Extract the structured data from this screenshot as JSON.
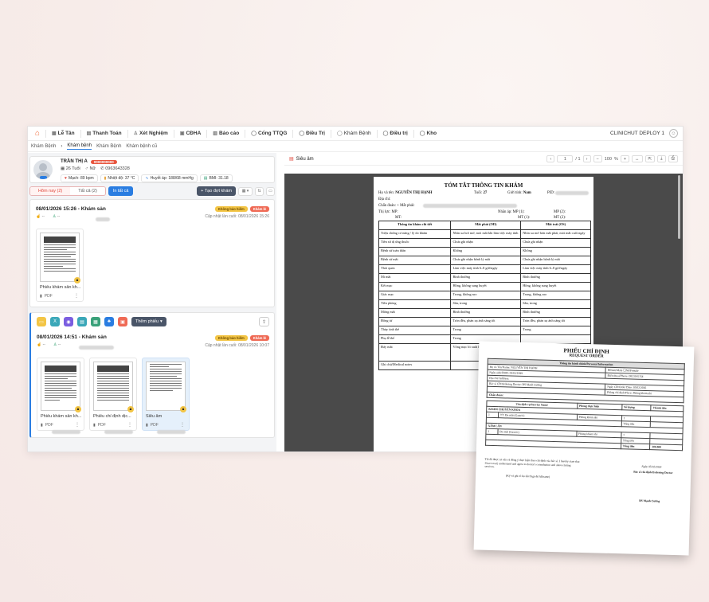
{
  "nav": {
    "items": [
      {
        "icon": "calendar-icon",
        "label": "Lễ Tân"
      },
      {
        "icon": "receipt-icon",
        "label": "Thanh Toán"
      },
      {
        "icon": "user-icon",
        "label": "Xét Nghiệm"
      },
      {
        "icon": "image-icon",
        "label": "CĐHA"
      },
      {
        "icon": "doc-icon",
        "label": "Báo cáo"
      },
      {
        "icon": "circle-icon",
        "label": "Cổng TTQG"
      },
      {
        "icon": "circle-icon",
        "label": "Điều Trị"
      },
      {
        "icon": "circle-icon",
        "label": "Khám Bệnh"
      },
      {
        "icon": "circle-icon",
        "label": "Điều trị"
      },
      {
        "icon": "circle-icon",
        "label": "Kho"
      }
    ],
    "right_label": "CLINICHUT DEPLOY 1"
  },
  "breadcrumb": {
    "items": [
      "Khám Bệnh",
      "Khám bệnh",
      "Khám Bệnh",
      "Khám bệnh cũ"
    ]
  },
  "patient": {
    "name": "TRẦN THỊ A",
    "id_badge": "0000000000",
    "age": "26 Tuổi",
    "gender": "Nữ",
    "phone": "0963643328",
    "vitals": [
      {
        "icon": "heart-icon",
        "text": "Mạch: 89 bpm"
      },
      {
        "icon": "thermometer-icon",
        "text": "Nhiệt độ: 37 °C"
      },
      {
        "icon": "pulse-icon",
        "text": "Huyết áp: 188/68 mmHg"
      },
      {
        "icon": "scale-icon",
        "text": "BMI: 31.18"
      }
    ]
  },
  "filters": {
    "today": "Hôm nay (2)",
    "all": "Tất cả (2)",
    "print_all": "In tất cả",
    "create": "+ Tạo đợt khám"
  },
  "visits": [
    {
      "title": "08/01/2026 15:26 - Khám sản",
      "tag_yellow": "Không bảo hiểm",
      "tag_red": "Khám lẻ",
      "updated": "Cập nhật lần cuối: 08/01/2026 15:26",
      "meta_a": "--",
      "meta_b": "--",
      "docs": [
        {
          "name": "Phiếu khám sản kh...",
          "type": "PDF"
        }
      ]
    },
    {
      "title": "08/01/2026 14:51 - Khám sản",
      "tag_yellow": "Không bảo hiểm",
      "tag_red": "Khám lẻ",
      "updated": "Cập nhật lần cuối: 08/01/2026 10:07",
      "meta_a": "--",
      "meta_b": "--",
      "more_button": "Thêm phiếu",
      "docs": [
        {
          "name": "Phiếu khám sản kh...",
          "type": "PDF"
        },
        {
          "name": "Phiếu chỉ định dịc...",
          "type": "PDF"
        },
        {
          "name": "Siêu âm",
          "type": "PDF"
        }
      ]
    }
  ],
  "viewer": {
    "title": "Siêu âm",
    "page_current": "1",
    "page_total": "/ 1",
    "zoom": "100",
    "zoom_unit": "%"
  },
  "summary": {
    "title": "TÓM TẮT THÔNG TIN KHÁM",
    "name_label": "Họ và tên:",
    "name": "NGUYỄN THỊ HẠNH",
    "age_label": "Tuổi:",
    "age": "27",
    "gender_label": "Giới tính:",
    "gender": "Nam",
    "pid_label": "PID:",
    "address_label": "Địa chỉ:",
    "diag_label": "Chẩn đoán:",
    "diag_value": "+ Mắt phải:",
    "vision_label": "Thị lực:",
    "mp_label": "MP:",
    "mt_label": "MT:",
    "iop_label": "Nhãn áp:",
    "iop_mp": "MP (1):",
    "iop_mt": "MT (1):",
    "mp2": "MP (2):",
    "mt2": "MT (2):",
    "headers": [
      "Thông tin khám chi tiết",
      "Mắt phải (OD)",
      "Mắt trái (OS)"
    ],
    "rows": [
      [
        "Triệu chứng cơ năng / lý do khám",
        "Nhìn xa hơi mờ, mỏi mắt khi làm việc máy tính",
        "Nhìn xa mờ hơn mắt phải, mỏi mắt cuối ngày"
      ],
      [
        "Tiền sử dị ứng thuốc",
        "Chưa ghi nhận",
        "Chưa ghi nhận"
      ],
      [
        "Bệnh sử toàn thân",
        "Không",
        "Không"
      ],
      [
        "Bệnh sử mắt",
        "Chưa ghi nhận bệnh lý mắt",
        "Chưa ghi nhận bệnh lý mắt"
      ],
      [
        "Thói quen",
        "Làm việc máy tính 6–8 giờ/ngày",
        "Làm việc máy tính 6–8 giờ/ngày"
      ],
      [
        "Mi mắt",
        "Bình thường",
        "Bình thường"
      ],
      [
        "Kết mạc",
        "Hồng, không sung huyết",
        "Hồng, không sung huyết"
      ],
      [
        "Giác mạc",
        "Trong, không sẹo",
        "Trong, không sẹo"
      ],
      [
        "Tiền phòng",
        "Sâu, trong",
        "Sâu, trong"
      ],
      [
        "Mống mắt",
        "Bình thường",
        "Bình thường"
      ],
      [
        "Đồng tử",
        "Tròn đều, phản xạ ánh sáng tốt",
        "Tròn đều, phản xạ ánh sáng tốt"
      ],
      [
        "Thủy tinh thể",
        "Trong",
        "Trong"
      ],
      [
        "Phụ lễ thể",
        "Trong",
        ""
      ],
      [
        "Đáy mắt",
        "Võng mạc bì xuất huyết",
        ""
      ],
      [
        "Ghi chú/Medical notes",
        "",
        ""
      ]
    ]
  },
  "request": {
    "title": "PHIẾU CHỈ ĐỊNH",
    "subtitle": "REQUEST ORDER",
    "section1": "Thông tin hành chính/Personal Information",
    "name_row": "Họ và Tên/Name: NGUYỄN THỊ HẠNH",
    "male": "Nam/Male",
    "female": "Nữ/Female",
    "dob": "Ngày sinh/DOB: 03/02/1999",
    "phone": "Điện thoại/Phone: 0823145154",
    "address": "Địa chỉ/ Address:",
    "doctor": "Bác sĩ CĐ/Ordering Doctor: BS Mạnh Cường",
    "order_date": "Ngày CĐ/Order Date: 05/02/2026",
    "place": "Phòng chỉ định/Place: Phòng khám nhi",
    "diagnosis": "Chẩn đoán:",
    "svc_headers": [
      "Tên dịch vụ/Service Name",
      "Phòng thực hiện",
      "Số lượng",
      "Thành tiền"
    ],
    "group1": "KHÁM CHUYÊN KHOA",
    "g1_row": [
      "1",
      "TT: Đo mắt (Gastric)",
      "Phòng khám nhi",
      "1",
      ""
    ],
    "g1_total": "Tổng tiền",
    "group2": "XÂM LẤN",
    "g2_row": [
      "1",
      "Đo mắt (Gastric)",
      "Phòng khám nhi",
      "1",
      ""
    ],
    "g2_total": "Tổng tiền",
    "grand_label": "Tổng tiền",
    "grand_value": "200.000",
    "consent": "Tôi đã được tư vấn và đồng ý thực hiện theo chỉ định của bác sĩ. I hereby state that I have read, understand and agree to doctor's consultation and above listing services.",
    "sign_patient": "(Ký và ghi rõ họ tên/Sign & fullname)",
    "date": "Ngày 05/02/2026",
    "doctor_title": "Bác sĩ chỉ định/Ordering Doctor",
    "doctor_name": "BS Mạnh Cường"
  },
  "colors": {
    "accent": "#2a7de1",
    "danger": "#e0463a",
    "warn": "#f3c545",
    "brand": "#f26b3a"
  }
}
